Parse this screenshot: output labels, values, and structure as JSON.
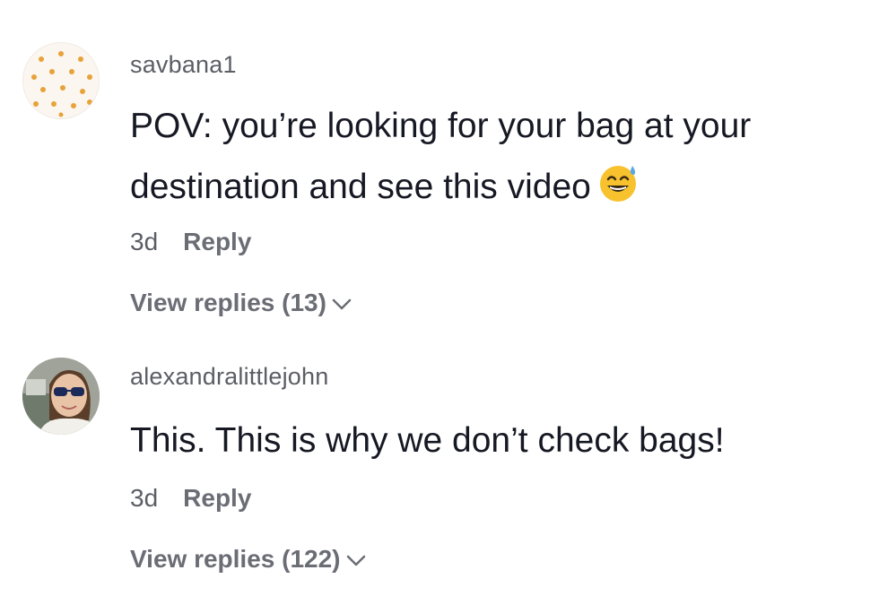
{
  "comments": [
    {
      "username": "savbana1",
      "text": "POV: you’re looking for your bag at your destination and see this video",
      "emoji_icon": "grinning-face-with-sweat-icon",
      "time": "3d",
      "reply_label": "Reply",
      "view_replies_label": "View replies (13)"
    },
    {
      "username": "alexandralittlejohn",
      "text": "This. This is why we don’t check bags!",
      "time": "3d",
      "reply_label": "Reply",
      "view_replies_label": "View replies (122)"
    }
  ],
  "colors": {
    "primary_text": "#161823",
    "secondary_text": "#5c5e66",
    "background": "#ffffff"
  }
}
